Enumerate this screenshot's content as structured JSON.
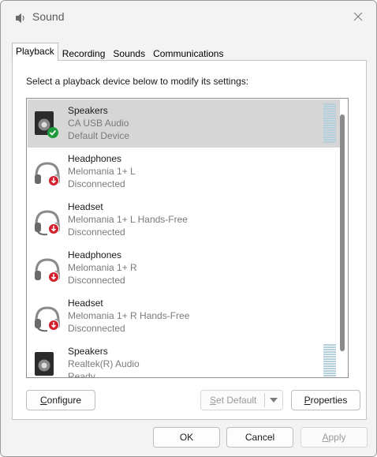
{
  "window": {
    "title": "Sound",
    "title_icon": "speaker-icon",
    "close_icon": "close-icon"
  },
  "tabs": [
    {
      "label": "Playback",
      "active": true
    },
    {
      "label": "Recording",
      "active": false
    },
    {
      "label": "Sounds",
      "active": false
    },
    {
      "label": "Communications",
      "active": false
    }
  ],
  "playback": {
    "instruction": "Select a playback device below to modify its settings:",
    "devices": [
      {
        "name": "Speakers",
        "description": "CA USB Audio",
        "status": "Default Device",
        "icon": "speaker-default-icon",
        "selected": true
      },
      {
        "name": "Headphones",
        "description": "Melomania 1+ L",
        "status": "Disconnected",
        "icon": "headphones-disconnected-icon",
        "selected": false
      },
      {
        "name": "Headset",
        "description": "Melomania 1+ L Hands-Free",
        "status": "Disconnected",
        "icon": "headset-disconnected-icon",
        "selected": false
      },
      {
        "name": "Headphones",
        "description": "Melomania 1+ R",
        "status": "Disconnected",
        "icon": "headphones-disconnected-icon",
        "selected": false
      },
      {
        "name": "Headset",
        "description": "Melomania 1+ R Hands-Free",
        "status": "Disconnected",
        "icon": "headset-disconnected-icon",
        "selected": false
      },
      {
        "name": "Speakers",
        "description": "Realtek(R) Audio",
        "status": "Ready",
        "icon": "speaker-icon",
        "selected": false
      }
    ]
  },
  "buttons": {
    "configure": {
      "pre": "",
      "key": "C",
      "post": "onfigure"
    },
    "set_default": {
      "pre": "",
      "key": "S",
      "post": "et Default"
    },
    "properties": {
      "pre": "",
      "key": "P",
      "post": "roperties"
    },
    "ok": "OK",
    "cancel": "Cancel",
    "apply": {
      "pre": "",
      "key": "A",
      "post": "pply"
    }
  },
  "colors": {
    "selection": "#d6d6d6",
    "meter": "#b5d0dc",
    "default_check": "#1f9a3a",
    "disconnected_badge": "#d2202f"
  }
}
